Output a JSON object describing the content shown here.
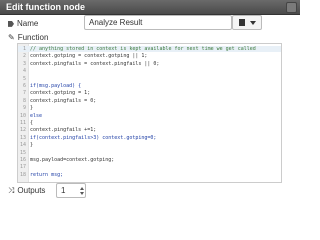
{
  "dialog": {
    "title": "Edit function node"
  },
  "name_field": {
    "label": "Name",
    "value": "Analyze Result"
  },
  "function_field": {
    "label": "Function",
    "lines": [
      {
        "n": "1",
        "text": "// anything stored in context is kept available for next time we get called",
        "type": "comment"
      },
      {
        "n": "2",
        "text": "context.gotping = context.gotping || 1;",
        "type": "code"
      },
      {
        "n": "3",
        "text": "context.pingfails = context.pingfails || 0;",
        "type": "code"
      },
      {
        "n": "4",
        "text": "",
        "type": "code"
      },
      {
        "n": "5",
        "text": "",
        "type": "code"
      },
      {
        "n": "6",
        "text": "if(msg.payload) {",
        "type": "kw"
      },
      {
        "n": "7",
        "text": "context.gotping = 1;",
        "type": "code"
      },
      {
        "n": "8",
        "text": "context.pingfails = 0;",
        "type": "code"
      },
      {
        "n": "9",
        "text": "}",
        "type": "code"
      },
      {
        "n": "10",
        "text": "else",
        "type": "kw"
      },
      {
        "n": "11",
        "text": "{",
        "type": "code"
      },
      {
        "n": "12",
        "text": "context.pingfails +=1;",
        "type": "code"
      },
      {
        "n": "13",
        "text": "if(context.pingfails>3) context.gotping=0;",
        "type": "kw"
      },
      {
        "n": "14",
        "text": "}",
        "type": "code"
      },
      {
        "n": "15",
        "text": "",
        "type": "code"
      },
      {
        "n": "16",
        "text": "msg.payload=context.gotping;",
        "type": "code"
      },
      {
        "n": "17",
        "text": "",
        "type": "code"
      },
      {
        "n": "18",
        "text": "return msg;",
        "type": "kw"
      }
    ]
  },
  "outputs_field": {
    "label": "Outputs",
    "value": "1"
  },
  "icons": {
    "name": "tag-icon",
    "function": "wrench-icon",
    "outputs": "random-icon",
    "close": "close-icon",
    "icon_select": "node-icon-select"
  },
  "colors": {
    "titlebar": "#555555",
    "comment": "#3c7a3c",
    "keyword": "#1f3fa6"
  }
}
